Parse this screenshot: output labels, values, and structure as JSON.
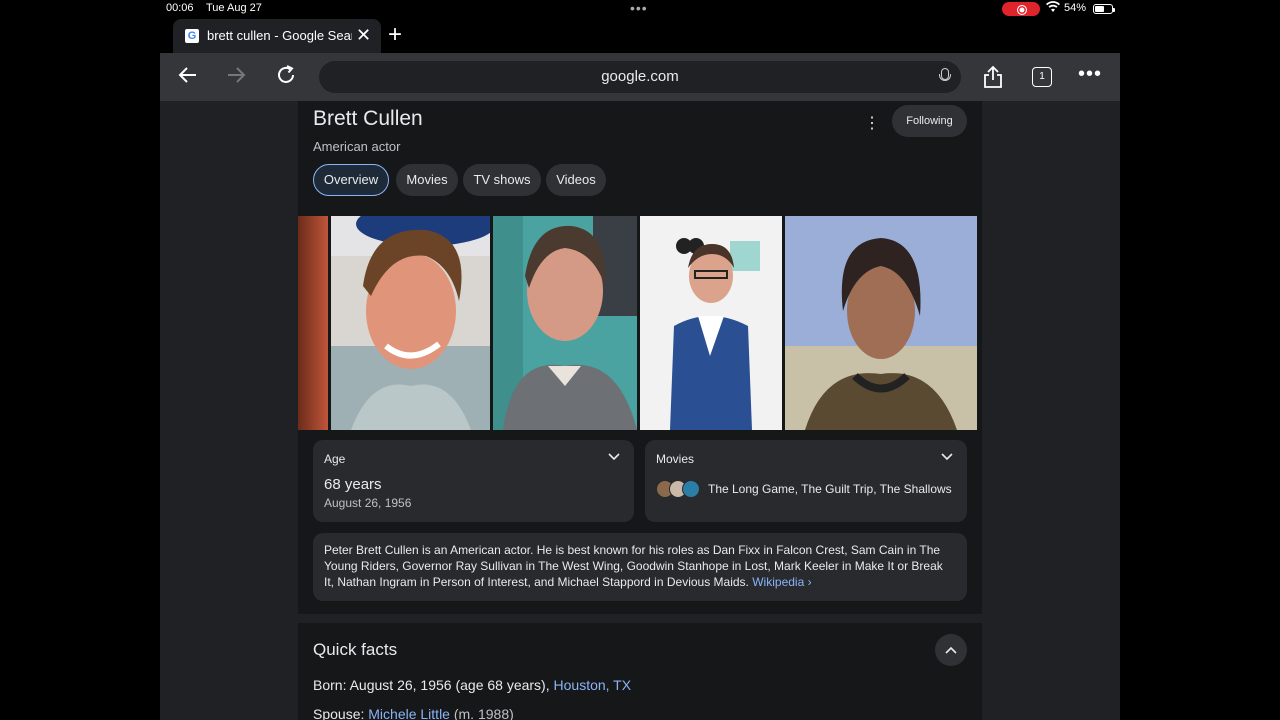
{
  "status": {
    "time": "00:06",
    "date": "Tue Aug 27",
    "battery": "54%"
  },
  "tab": {
    "title": "brett cullen - Google Search",
    "favicon": "G"
  },
  "toolbar": {
    "url": "google.com",
    "tab_count": "1"
  },
  "entity": {
    "name": "Brett Cullen",
    "subtitle": "American actor",
    "following_label": "Following",
    "chips": [
      "Overview",
      "Movies",
      "TV shows",
      "Videos"
    ]
  },
  "age": {
    "label": "Age",
    "value": "68 years",
    "date": "August 26, 1956"
  },
  "movies": {
    "label": "Movies",
    "list": "The Long Game, The Guilt Trip, The Shallows"
  },
  "description": {
    "text": "Peter Brett Cullen is an American actor. He is best known for his roles as Dan Fixx in Falcon Crest, Sam Cain in The Young Riders, Governor Ray Sullivan in The West Wing, Goodwin Stanhope in Lost, Mark Keeler in Make It or Break It, Nathan Ingram in Person of Interest, and Michael Stappord in Devious Maids.",
    "source": "Wikipedia"
  },
  "quick_facts": {
    "title": "Quick facts",
    "born_label": "Born",
    "born_value": "August 26, 1956 (age 68 years),",
    "born_place": "Houston, TX",
    "spouse_label": "Spouse",
    "spouse_name": "Michele Little",
    "spouse_note": "(m. 1988)"
  },
  "colors": {
    "link": "#8ab4f8",
    "page_bg": "#202124",
    "card_bg": "#161718",
    "recording": "#e0242b"
  }
}
